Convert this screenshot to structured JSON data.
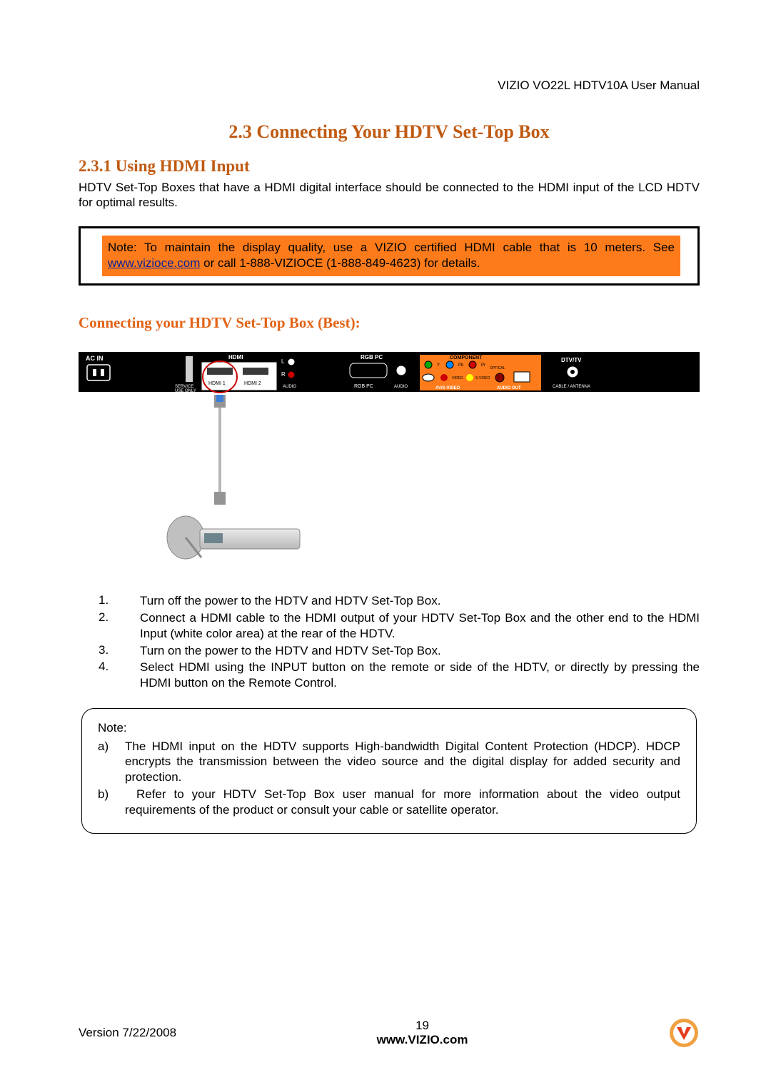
{
  "header": {
    "manual_title": "VIZIO VO22L HDTV10A User Manual"
  },
  "section": {
    "title": "2.3 Connecting Your HDTV Set-Top Box",
    "subsection_title": "2.3.1 Using HDMI Input",
    "intro": "HDTV Set-Top Boxes that have a HDMI digital interface should be connected to the HDMI input of the LCD HDTV for optimal results."
  },
  "callout": {
    "prefix": "Note: To maintain the display quality, use a VIZIO certified HDMI cable that is 10 meters. See ",
    "link_text": "www.vizioce.com",
    "link_href": "http://www.vizioce.com",
    "suffix": " or call 1-888-VIZIOCE (1-888-849-4623) for details."
  },
  "orange_sub": "Connecting your HDTV Set-Top Box (Best):",
  "diagram": {
    "labels": {
      "ac_in": "AC IN",
      "service": "SERVICE",
      "use_only": "USE ONLY",
      "hdmi": "HDMI",
      "hdmi1": "HDMI 1",
      "hdmi2": "HDMI 2",
      "rgb_pc": "RGB PC",
      "rgb_pc_small": "RGB PC",
      "audio": "AUDIO",
      "l": "L",
      "r": "R",
      "component": "COMPONENT",
      "y": "Y",
      "pb": "Pb",
      "pr": "Pr",
      "av_audio": "AUDIO",
      "video": "VIDEO",
      "svideo": "S-VIDEO",
      "optical": "OPTICAL",
      "avs_video": "AV/S-VIDEO",
      "audio_out": "AUDIO OUT",
      "dtv_tv": "DTV/TV",
      "cable_ant": "CABLE / ANTENNA"
    }
  },
  "steps": [
    {
      "n": "1.",
      "t": "Turn off the power to the HDTV and HDTV Set-Top Box."
    },
    {
      "n": "2.",
      "t": "Connect a HDMI cable to the HDMI output of your HDTV Set-Top Box and the other end to the HDMI Input (white color area) at the rear of the HDTV."
    },
    {
      "n": "3.",
      "t": "Turn on the power to the HDTV and HDTV Set-Top Box."
    },
    {
      "n": "4.",
      "t": "Select HDMI using the INPUT button on the remote or side of the HDTV, or directly by pressing the HDMI button on the Remote Control."
    }
  ],
  "note_box": {
    "label": "Note:",
    "items": [
      {
        "b": "a)",
        "t": "The HDMI input on the HDTV supports High-bandwidth Digital Content Protection (HDCP). HDCP encrypts the transmission between the video source and the digital display for added security and protection."
      },
      {
        "b": "b)",
        "t": "Refer to your HDTV Set-Top Box user manual for more information about the video output requirements of the product or consult your cable or satellite operator.",
        "indent": true
      }
    ]
  },
  "footer": {
    "version": "Version 7/22/2008",
    "page": "19",
    "url": "www.VIZIO.com"
  }
}
